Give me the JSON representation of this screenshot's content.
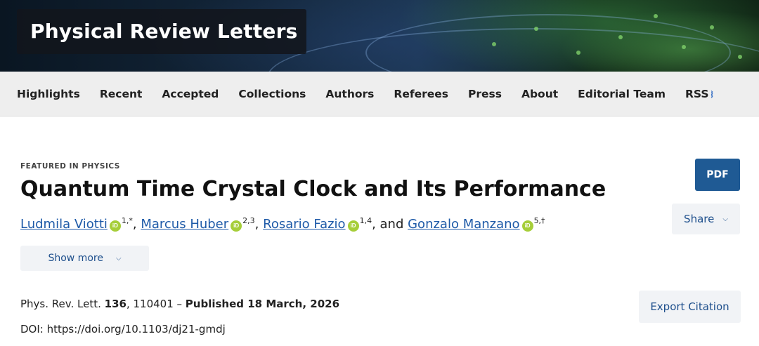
{
  "journal": {
    "name": "Physical Review Letters"
  },
  "nav": {
    "items": [
      "Highlights",
      "Recent",
      "Accepted",
      "Collections",
      "Authors",
      "Referees",
      "Press",
      "About",
      "Editorial Team",
      "RSS"
    ]
  },
  "article": {
    "kicker": "FEATURED IN PHYSICS",
    "title": "Quantum Time Crystal Clock and Its Performance",
    "authors": [
      {
        "name": "Ludmila Viotti",
        "affil": "1,*"
      },
      {
        "name": "Marcus Huber",
        "affil": "2,3"
      },
      {
        "name": "Rosario Fazio",
        "affil": "1,4"
      },
      {
        "name": "Gonzalo Manzano",
        "affil": "5,†"
      }
    ],
    "author_sep": ", ",
    "author_and": ", and ",
    "show_more_label": "Show more",
    "citation": {
      "journal": "Phys. Rev. Lett. ",
      "volume": "136",
      "article_no": ", 110401 – ",
      "published": "Published 18 March, 2026"
    },
    "doi": "DOI: https://doi.org/10.1103/dj21-gmdj"
  },
  "actions": {
    "pdf_label": "PDF",
    "share_label": "Share",
    "export_label": "Export Citation"
  },
  "icons": {
    "orcid": "orcid-icon",
    "rss": "rss-icon",
    "chevron": "chevron-down-icon"
  },
  "colors": {
    "link": "#1e5aa8",
    "pdf_button": "#1f5a94",
    "orcid": "#a6ce39"
  }
}
